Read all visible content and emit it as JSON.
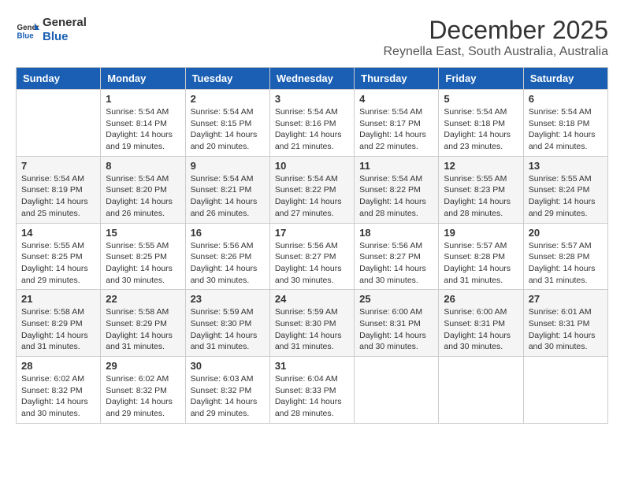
{
  "header": {
    "logo_line1": "General",
    "logo_line2": "Blue",
    "title": "December 2025",
    "subtitle": "Reynella East, South Australia, Australia"
  },
  "columns": [
    "Sunday",
    "Monday",
    "Tuesday",
    "Wednesday",
    "Thursday",
    "Friday",
    "Saturday"
  ],
  "weeks": [
    [
      {
        "day": "",
        "info": ""
      },
      {
        "day": "1",
        "info": "Sunrise: 5:54 AM\nSunset: 8:14 PM\nDaylight: 14 hours\nand 19 minutes."
      },
      {
        "day": "2",
        "info": "Sunrise: 5:54 AM\nSunset: 8:15 PM\nDaylight: 14 hours\nand 20 minutes."
      },
      {
        "day": "3",
        "info": "Sunrise: 5:54 AM\nSunset: 8:16 PM\nDaylight: 14 hours\nand 21 minutes."
      },
      {
        "day": "4",
        "info": "Sunrise: 5:54 AM\nSunset: 8:17 PM\nDaylight: 14 hours\nand 22 minutes."
      },
      {
        "day": "5",
        "info": "Sunrise: 5:54 AM\nSunset: 8:18 PM\nDaylight: 14 hours\nand 23 minutes."
      },
      {
        "day": "6",
        "info": "Sunrise: 5:54 AM\nSunset: 8:18 PM\nDaylight: 14 hours\nand 24 minutes."
      }
    ],
    [
      {
        "day": "7",
        "info": "Sunrise: 5:54 AM\nSunset: 8:19 PM\nDaylight: 14 hours\nand 25 minutes."
      },
      {
        "day": "8",
        "info": "Sunrise: 5:54 AM\nSunset: 8:20 PM\nDaylight: 14 hours\nand 26 minutes."
      },
      {
        "day": "9",
        "info": "Sunrise: 5:54 AM\nSunset: 8:21 PM\nDaylight: 14 hours\nand 26 minutes."
      },
      {
        "day": "10",
        "info": "Sunrise: 5:54 AM\nSunset: 8:22 PM\nDaylight: 14 hours\nand 27 minutes."
      },
      {
        "day": "11",
        "info": "Sunrise: 5:54 AM\nSunset: 8:22 PM\nDaylight: 14 hours\nand 28 minutes."
      },
      {
        "day": "12",
        "info": "Sunrise: 5:55 AM\nSunset: 8:23 PM\nDaylight: 14 hours\nand 28 minutes."
      },
      {
        "day": "13",
        "info": "Sunrise: 5:55 AM\nSunset: 8:24 PM\nDaylight: 14 hours\nand 29 minutes."
      }
    ],
    [
      {
        "day": "14",
        "info": "Sunrise: 5:55 AM\nSunset: 8:25 PM\nDaylight: 14 hours\nand 29 minutes."
      },
      {
        "day": "15",
        "info": "Sunrise: 5:55 AM\nSunset: 8:25 PM\nDaylight: 14 hours\nand 30 minutes."
      },
      {
        "day": "16",
        "info": "Sunrise: 5:56 AM\nSunset: 8:26 PM\nDaylight: 14 hours\nand 30 minutes."
      },
      {
        "day": "17",
        "info": "Sunrise: 5:56 AM\nSunset: 8:27 PM\nDaylight: 14 hours\nand 30 minutes."
      },
      {
        "day": "18",
        "info": "Sunrise: 5:56 AM\nSunset: 8:27 PM\nDaylight: 14 hours\nand 30 minutes."
      },
      {
        "day": "19",
        "info": "Sunrise: 5:57 AM\nSunset: 8:28 PM\nDaylight: 14 hours\nand 31 minutes."
      },
      {
        "day": "20",
        "info": "Sunrise: 5:57 AM\nSunset: 8:28 PM\nDaylight: 14 hours\nand 31 minutes."
      }
    ],
    [
      {
        "day": "21",
        "info": "Sunrise: 5:58 AM\nSunset: 8:29 PM\nDaylight: 14 hours\nand 31 minutes."
      },
      {
        "day": "22",
        "info": "Sunrise: 5:58 AM\nSunset: 8:29 PM\nDaylight: 14 hours\nand 31 minutes."
      },
      {
        "day": "23",
        "info": "Sunrise: 5:59 AM\nSunset: 8:30 PM\nDaylight: 14 hours\nand 31 minutes."
      },
      {
        "day": "24",
        "info": "Sunrise: 5:59 AM\nSunset: 8:30 PM\nDaylight: 14 hours\nand 31 minutes."
      },
      {
        "day": "25",
        "info": "Sunrise: 6:00 AM\nSunset: 8:31 PM\nDaylight: 14 hours\nand 30 minutes."
      },
      {
        "day": "26",
        "info": "Sunrise: 6:00 AM\nSunset: 8:31 PM\nDaylight: 14 hours\nand 30 minutes."
      },
      {
        "day": "27",
        "info": "Sunrise: 6:01 AM\nSunset: 8:31 PM\nDaylight: 14 hours\nand 30 minutes."
      }
    ],
    [
      {
        "day": "28",
        "info": "Sunrise: 6:02 AM\nSunset: 8:32 PM\nDaylight: 14 hours\nand 30 minutes."
      },
      {
        "day": "29",
        "info": "Sunrise: 6:02 AM\nSunset: 8:32 PM\nDaylight: 14 hours\nand 29 minutes."
      },
      {
        "day": "30",
        "info": "Sunrise: 6:03 AM\nSunset: 8:32 PM\nDaylight: 14 hours\nand 29 minutes."
      },
      {
        "day": "31",
        "info": "Sunrise: 6:04 AM\nSunset: 8:33 PM\nDaylight: 14 hours\nand 28 minutes."
      },
      {
        "day": "",
        "info": ""
      },
      {
        "day": "",
        "info": ""
      },
      {
        "day": "",
        "info": ""
      }
    ]
  ]
}
